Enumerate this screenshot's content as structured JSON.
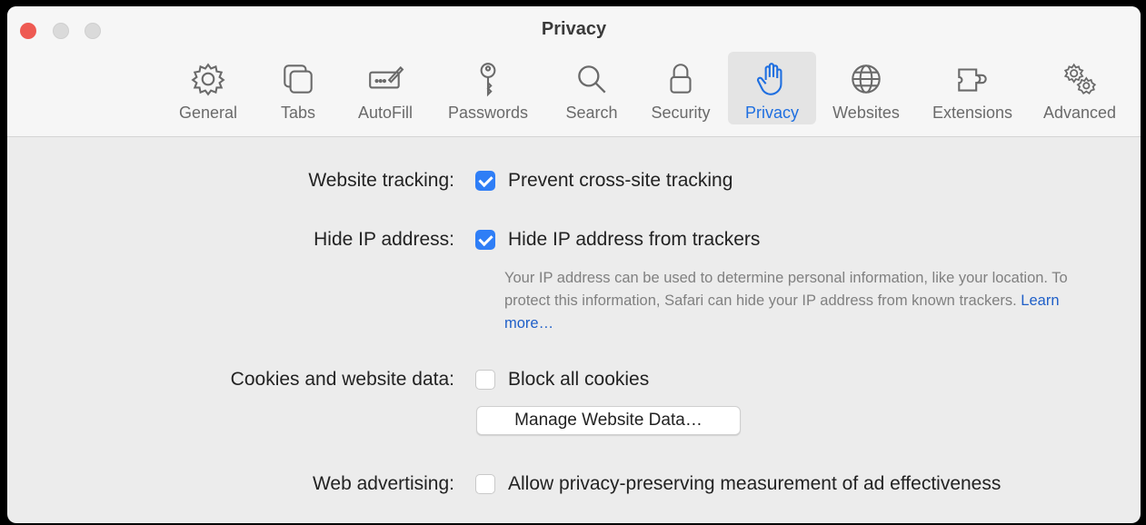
{
  "window": {
    "title": "Privacy"
  },
  "tabs": [
    {
      "label": "General",
      "icon": "gear-icon"
    },
    {
      "label": "Tabs",
      "icon": "tabs-icon"
    },
    {
      "label": "AutoFill",
      "icon": "autofill-icon"
    },
    {
      "label": "Passwords",
      "icon": "key-icon"
    },
    {
      "label": "Search",
      "icon": "search-icon"
    },
    {
      "label": "Security",
      "icon": "lock-icon"
    },
    {
      "label": "Privacy",
      "icon": "hand-icon",
      "selected": true
    },
    {
      "label": "Websites",
      "icon": "globe-icon"
    },
    {
      "label": "Extensions",
      "icon": "puzzle-icon"
    },
    {
      "label": "Advanced",
      "icon": "gears-icon"
    }
  ],
  "settings": {
    "website_tracking": {
      "label": "Website tracking:",
      "option": "Prevent cross-site tracking",
      "checked": true
    },
    "hide_ip": {
      "label": "Hide IP address:",
      "option": "Hide IP address from trackers",
      "checked": true,
      "description": "Your IP address can be used to determine personal information, like your location. To protect this information, Safari can hide your IP address from known trackers.",
      "link": "Learn more…"
    },
    "cookies": {
      "label": "Cookies and website data:",
      "option": "Block all cookies",
      "checked": false,
      "button": "Manage Website Data…"
    },
    "web_advertising": {
      "label": "Web advertising:",
      "option": "Allow privacy-preserving measurement of ad effectiveness",
      "checked": false
    }
  },
  "colors": {
    "accent": "#2f7ef6",
    "selected_tab_text": "#1f6fe0",
    "close_button": "#ee5a52",
    "link": "#1f5fc8"
  }
}
